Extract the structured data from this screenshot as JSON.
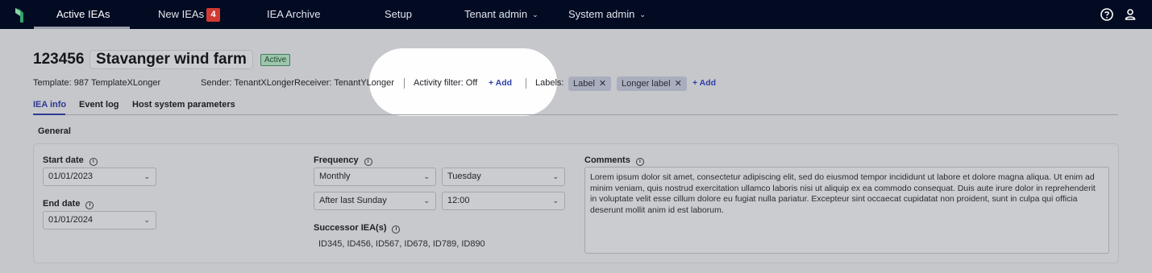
{
  "nav": {
    "items": [
      {
        "label": "Active IEAs"
      },
      {
        "label": "New IEAs",
        "badge": "4"
      },
      {
        "label": "IEA Archive"
      },
      {
        "label": "Setup"
      },
      {
        "label": "Tenant admin"
      },
      {
        "label": "System admin"
      }
    ],
    "help_icon": "help-circle-icon",
    "user_icon": "user-icon"
  },
  "header": {
    "id": "123456",
    "name": "Stavanger wind farm",
    "status": "Active"
  },
  "meta": {
    "template": "Template: 987 TemplateXLonger",
    "sender": "Sender: TenantXLonger",
    "receiver": "Receiver: TenantYLonger",
    "activity_filter": "Activity filter: Off",
    "add_filter": "+ Add",
    "labels_title": "Labels:",
    "labels": [
      "Label",
      "Longer label"
    ],
    "add_label": "+ Add",
    "remove_glyph": "✕"
  },
  "tabs": [
    "IEA info",
    "Event log",
    "Host system parameters"
  ],
  "general": {
    "title": "General",
    "start_date_label": "Start date",
    "start_date": "01/01/2023",
    "end_date_label": "End date",
    "end_date": "01/01/2024",
    "frequency_label": "Frequency",
    "frequency": "Monthly",
    "day": "Tuesday",
    "rule": "After last Sunday",
    "time": "12:00",
    "successor_label": "Successor IEA(s)",
    "successors": "ID345, ID456, ID567, ID678, ID789, ID890",
    "comments_label": "Comments",
    "comments": "Lorem ipsum dolor sit amet, consectetur adipiscing elit, sed do eiusmod tempor incididunt ut labore et dolore magna aliqua. Ut enim ad minim veniam, quis nostrud exercitation ullamco laboris nisi ut aliquip ex ea commodo consequat. Duis aute irure dolor in reprehenderit in voluptate velit esse cillum dolore eu fugiat nulla pariatur. Excepteur sint occaecat cupidatat non proident, sunt in culpa qui officia deserunt mollit anim id est laborum."
  },
  "colors": {
    "nav_bg": "#020b22",
    "accent": "#2c3993",
    "badge": "#d13a32",
    "status_bg": "#9fc5ad"
  }
}
